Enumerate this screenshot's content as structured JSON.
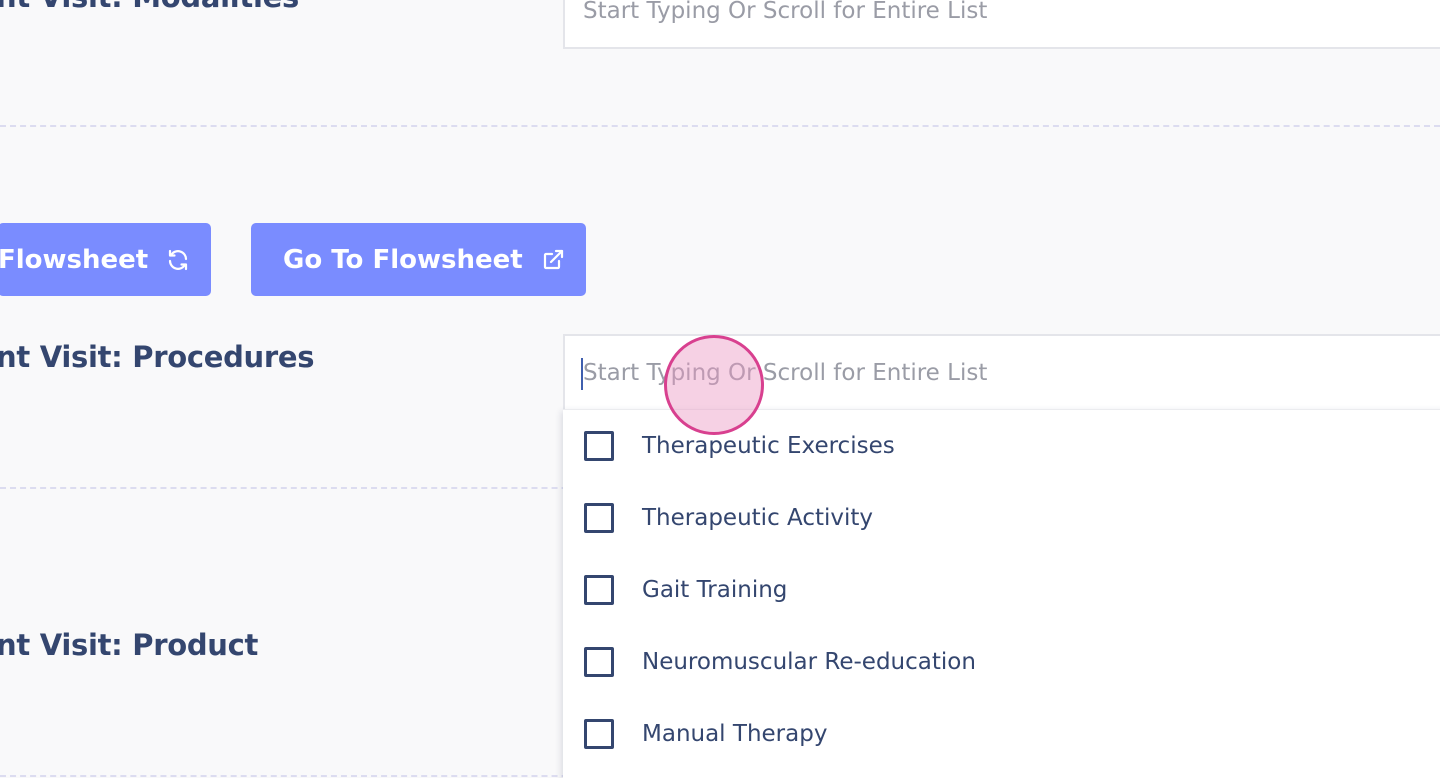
{
  "sections": {
    "modalities_label": "nt Visit: Modalities",
    "procedures_label": "nt Visit: Procedures",
    "product_label": "nt Visit: Product"
  },
  "modalities_field": {
    "placeholder": "Start Typing Or Scroll for Entire List"
  },
  "procedures_field": {
    "placeholder": "Start Typing Or Scroll for Entire List",
    "value": ""
  },
  "buttons": {
    "refresh_flowsheet_label": "Flowsheet",
    "refresh_icon": "refresh-icon",
    "go_to_flowsheet_label": "Go To Flowsheet",
    "external_link_icon": "external-link-icon"
  },
  "procedures_options": [
    {
      "label": "Therapeutic Exercises",
      "checked": false
    },
    {
      "label": "Therapeutic Activity",
      "checked": false
    },
    {
      "label": "Gait Training",
      "checked": false
    },
    {
      "label": "Neuromuscular Re-education",
      "checked": false
    },
    {
      "label": "Manual Therapy",
      "checked": false
    }
  ],
  "colors": {
    "accent_button": "#7a8cff",
    "label_text": "#34466f",
    "click_indicator": "#d8408f"
  }
}
